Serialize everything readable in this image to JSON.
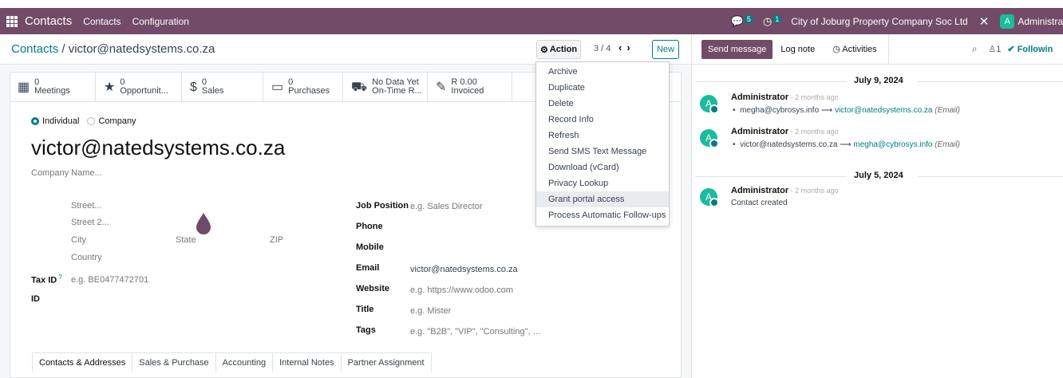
{
  "topbar": {
    "app": "Contacts",
    "menu": [
      "Contacts",
      "Configuration"
    ],
    "messages_count": "5",
    "activities_count": "1",
    "company": "City of Joburg Property Company Soc Ltd",
    "user_initial": "A",
    "user": "Administra"
  },
  "breadcrumb": {
    "parent": "Contacts",
    "current": "victor@natedsystems.co.za"
  },
  "toolbar": {
    "action": "Action",
    "pager": "3 / 4",
    "new": "New"
  },
  "stats": [
    {
      "value": "0",
      "label": "Meetings"
    },
    {
      "value": "0",
      "label": "Opportunit..."
    },
    {
      "value": "0",
      "label": "Sales"
    },
    {
      "value": "0",
      "label": "Purchases"
    },
    {
      "value": "No Data Yet",
      "label": "On-Time R..."
    },
    {
      "value": "R 0.00",
      "label": "Invoiced"
    }
  ],
  "form": {
    "type_individual": "Individual",
    "type_company": "Company",
    "name": "victor@natedsystems.co.za",
    "company_ph": "Company Name...",
    "street": "Street...",
    "street2": "Street 2...",
    "city": "City",
    "state": "State",
    "zip": "ZIP",
    "country": "Country",
    "tax_label": "Tax ID",
    "tax_help": "?",
    "tax_ph": "e.g. BE0477472701",
    "id_label": "ID",
    "job_label": "Job Position",
    "job_ph": "e.g. Sales Director",
    "phone_label": "Phone",
    "mobile_label": "Mobile",
    "email_label": "Email",
    "email": "victor@natedsystems.co.za",
    "website_label": "Website",
    "website_ph": "e.g. https://www.odoo.com",
    "title_label": "Title",
    "title_ph": "e.g. Mister",
    "tags_label": "Tags",
    "tags_ph": "e.g. \"B2B\", \"VIP\", \"Consulting\", ..."
  },
  "tabs": [
    "Contacts & Addresses",
    "Sales & Purchase",
    "Accounting",
    "Internal Notes",
    "Partner Assignment"
  ],
  "dropdown": [
    "Archive",
    "Duplicate",
    "Delete",
    "Record Info",
    "Refresh",
    "Send SMS Text Message",
    "Download (vCard)",
    "Privacy Lookup",
    "Grant portal access",
    "Process Automatic Follow-ups"
  ],
  "chatter": {
    "send": "Send message",
    "log": "Log note",
    "activities": "Activities",
    "followers": "1",
    "following": "Followin",
    "date1": "July 9, 2024",
    "date2": "July 5, 2024",
    "m1": {
      "author": "Administrator",
      "ago": " - 2 months ago",
      "from": "megha@cybrosys.info",
      "to": "victor@natedsystems.co.za",
      "kind": "(Email)"
    },
    "m2": {
      "author": "Administrator",
      "ago": " - 2 months ago",
      "from": "victor@natedsystems.co.za",
      "to": "megha@cybrosys.info",
      "kind": "(Email)"
    },
    "m3": {
      "author": "Administrator",
      "ago": " - 2 months ago",
      "text": "Contact created"
    }
  },
  "colors": {
    "brand": "#714B67",
    "accent": "#017E84"
  }
}
